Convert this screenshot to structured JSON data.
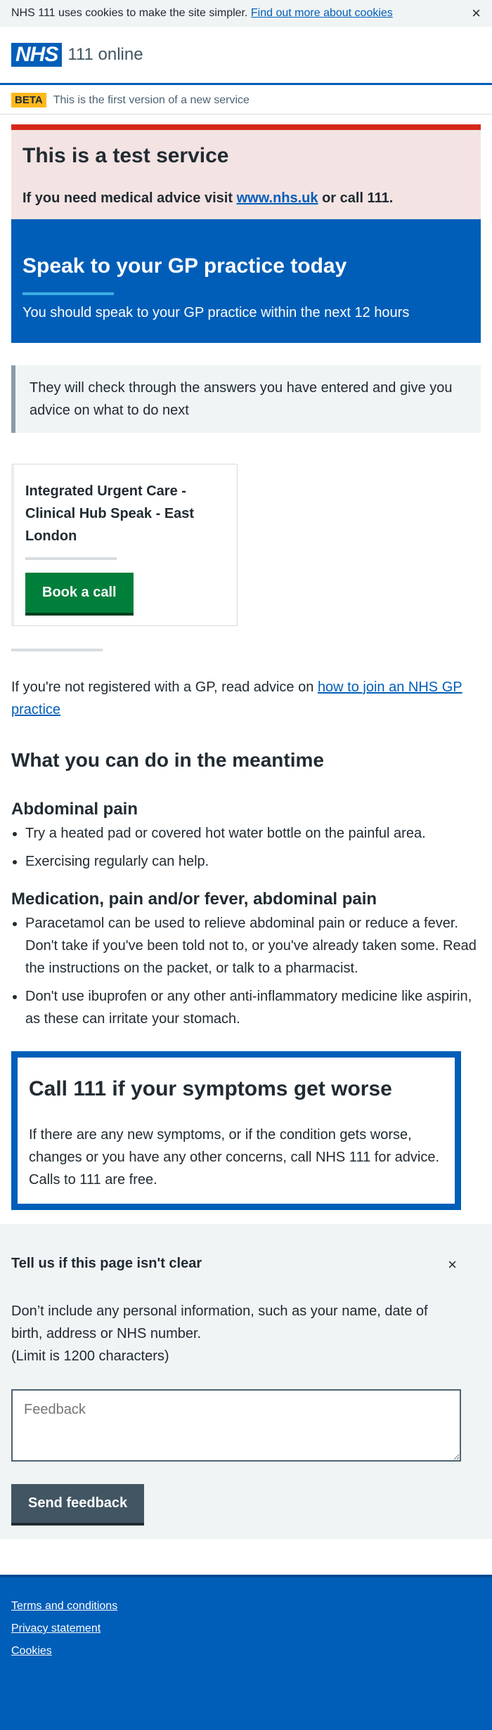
{
  "cookie_banner": {
    "text": "NHS 111 uses cookies to make the site simpler.",
    "link": "Find out more about cookies",
    "close": "×"
  },
  "header": {
    "logo": "NHS",
    "service_name": "111 online"
  },
  "beta_banner": {
    "tag": "BETA",
    "text": "This is the first version of a new service"
  },
  "test_notice": {
    "title": "This is a test service",
    "text_before": "If you need medical advice visit",
    "link": "www.nhs.uk",
    "text_after": "or call 111."
  },
  "outcome": {
    "title": "Speak to your GP practice today",
    "subtitle": "You should speak to your GP practice within the next 12 hours"
  },
  "inset_text": "They will check through the answers you have entered and give you advice on what to do next",
  "service": {
    "name": "Integrated Urgent Care - Clinical Hub Speak - East London",
    "button": "Book a call"
  },
  "gp_advice": {
    "text": "If you're not registered with a GP, read advice on",
    "link": "how to join an NHS GP practice"
  },
  "meantime": {
    "title": "What you can do in the meantime",
    "sections": [
      {
        "heading": "Abdominal pain",
        "items": [
          "Try a heated pad or covered hot water bottle on the painful area.",
          "Exercising regularly can help."
        ]
      },
      {
        "heading": "Medication, pain and/or fever, abdominal pain",
        "items": [
          "Paracetamol can be used to relieve abdominal pain or reduce a fever. Don't take if you've been told not to, or you've already taken some. Read the instructions on the packet, or talk to a pharmacist.",
          "Don't use ibuprofen or any other anti-inflammatory medicine like aspirin, as these can irritate your stomach."
        ]
      }
    ]
  },
  "worsening": {
    "title": "Call 111 if your symptoms get worse",
    "text": "If there are any new symptoms, or if the condition gets worse, changes or you have any other concerns, call NHS 111 for advice. Calls to 111 are free."
  },
  "feedback": {
    "title": "Tell us if this page isn't clear",
    "close": "×",
    "description": "Don’t include any personal information, such as your name, date of birth, address or NHS number.",
    "limit": "(Limit is 1200 characters)",
    "placeholder": "Feedback",
    "button": "Send feedback"
  },
  "footer": {
    "links": [
      "Terms and conditions",
      "Privacy statement",
      "Cookies"
    ]
  }
}
